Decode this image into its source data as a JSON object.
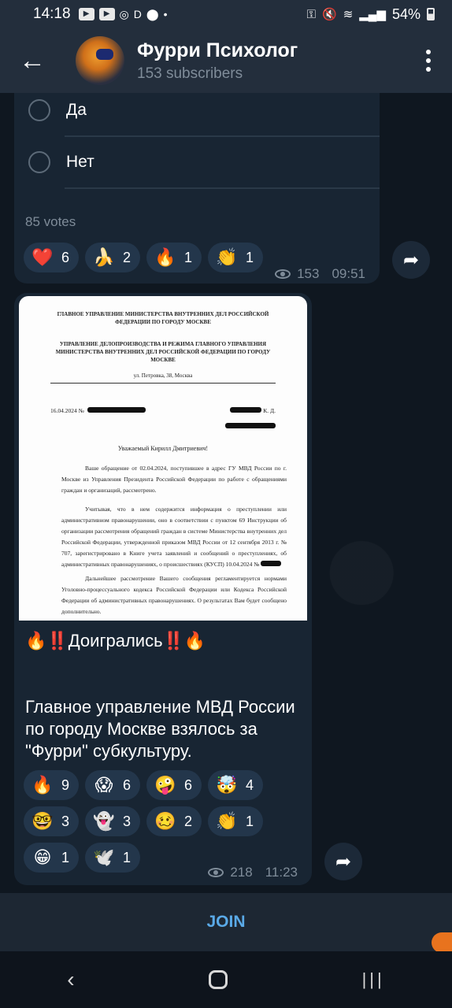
{
  "status": {
    "time": "14:18",
    "battery": "54%",
    "icons": [
      "youtube-icon",
      "youtube-icon",
      "instagram-icon",
      "d-app-icon",
      "location-icon"
    ]
  },
  "header": {
    "title": "Фурри Психолог",
    "subtitle": "153 subscribers"
  },
  "poll": {
    "options": [
      "Да",
      "Нет"
    ],
    "votes": "85 votes",
    "reactions": [
      {
        "emoji": "❤️",
        "count": "6"
      },
      {
        "emoji": "🍌",
        "count": "2"
      },
      {
        "emoji": "🔥",
        "count": "1"
      },
      {
        "emoji": "👏",
        "count": "1"
      }
    ],
    "views": "153",
    "time": "09:51"
  },
  "post": {
    "document": {
      "header1": "ГЛАВНОЕ УПРАВЛЕНИЕ МИНИСТЕРСТВА ВНУТРЕННИХ ДЕЛ РОССИЙСКОЙ ФЕДЕРАЦИИ ПО ГОРОДУ МОСКВЕ",
      "header2": "УПРАВЛЕНИЕ ДЕЛОПРОИЗВОДСТВА И РЕЖИМА ГЛАВНОГО УПРАВЛЕНИЯ МИНИСТЕРСТВА ВНУТРЕННИХ ДЕЛ РОССИЙСКОЙ ФЕДЕРАЦИИ ПО ГОРОДУ МОСКВЕ",
      "address": "ул. Петровка, 38, Москва",
      "date": "16.04.2024 №",
      "addressee_suffix": "К. Д.",
      "greeting": "Уважаемый Кирилл Дмитриевич!",
      "para1": "Ваше обращение от 02.04.2024, поступившее в адрес ГУ МВД России по г. Москве из Управления Президента Российской Федерации по работе с обращениями граждан и организаций, рассмотрено.",
      "para2": "Учитывая, что в нем содержится информация о преступлении или административном правонарушении, оно в соответствии с пунктом 69 Инструкции об организации рассмотрения обращений граждан в системе Министерства внутренних дел Российской Федерации, утвержденной приказом МВД России от 12 сентября 2013 г. № 707, зарегистрировано в Книге учета заявлений и сообщений о преступлениях, об административных правонарушениях, о происшествиях (КУСП) 10.04.2024 №",
      "para3": "Дальнейшее рассмотрение Вашего сообщения регламентируется нормами Уголовно-процессуального кодекса Российской Федерации или Кодекса Российской Федерации об административных правонарушениях. О результатах Вам будет сообщено дополнительно."
    },
    "headline": "🔥‼️Доигрались‼️🔥",
    "body": "Главное управление МВД России по городу Москве взялось за \"Фурри\" субкультуру.",
    "reactions": [
      {
        "emoji": "🔥",
        "count": "9"
      },
      {
        "emoji": "😱",
        "count": "6"
      },
      {
        "emoji": "🤪",
        "count": "6"
      },
      {
        "emoji": "🤯",
        "count": "4"
      },
      {
        "emoji": "🤓",
        "count": "3"
      },
      {
        "emoji": "👻",
        "count": "3"
      },
      {
        "emoji": "🥴",
        "count": "2"
      },
      {
        "emoji": "👏",
        "count": "1"
      },
      {
        "emoji": "😁",
        "count": "1"
      },
      {
        "emoji": "🕊️",
        "count": "1"
      }
    ],
    "views": "218",
    "time": "11:23"
  },
  "footer": {
    "join_label": "JOIN"
  }
}
